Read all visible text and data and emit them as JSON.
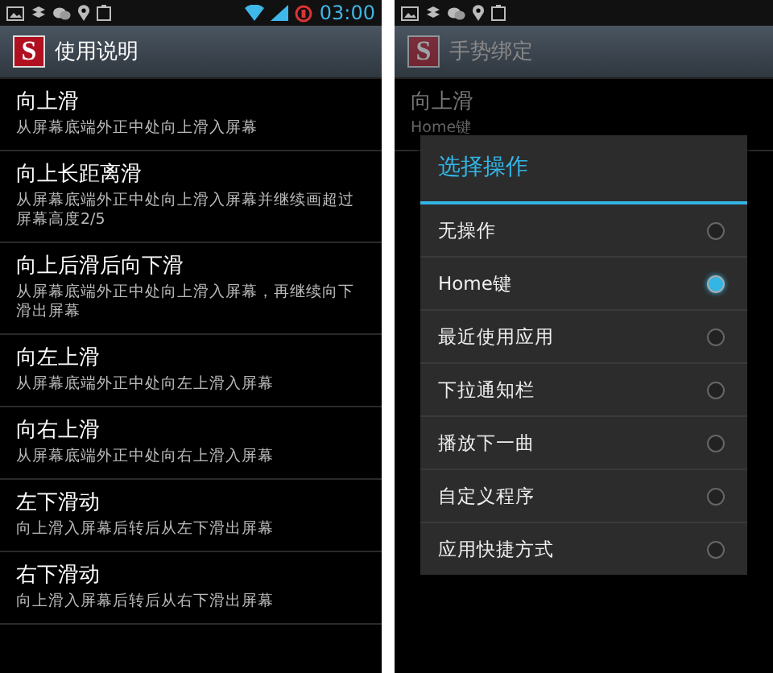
{
  "left_screen": {
    "status_bar": {
      "time": "03:00"
    },
    "app_logo": "S",
    "title": "使用说明",
    "items": [
      {
        "title": "向上滑",
        "description": "从屏幕底端外正中处向上滑入屏幕"
      },
      {
        "title": "向上长距离滑",
        "description": "从屏幕底端外正中处向上滑入屏幕并继续画超过屏幕高度2/5"
      },
      {
        "title": "向上后滑后向下滑",
        "description": "从屏幕底端外正中处向上滑入屏幕，再继续向下滑出屏幕"
      },
      {
        "title": "向左上滑",
        "description": "从屏幕底端外正中处向左上滑入屏幕"
      },
      {
        "title": "向右上滑",
        "description": "从屏幕底端外正中处向右上滑入屏幕"
      },
      {
        "title": "左下滑动",
        "description": "向上滑入屏幕后转后从左下滑出屏幕"
      },
      {
        "title": "右下滑动",
        "description": "向上滑入屏幕后转后从右下滑出屏幕"
      }
    ]
  },
  "right_screen": {
    "app_logo": "S",
    "title": "手势绑定",
    "items": [
      {
        "title": "向上滑",
        "value": "Home键"
      }
    ],
    "dialog": {
      "title": "选择操作",
      "options": [
        {
          "label": "无操作",
          "selected": false
        },
        {
          "label": "Home键",
          "selected": true
        },
        {
          "label": "最近使用应用",
          "selected": false
        },
        {
          "label": "下拉通知栏",
          "selected": false
        },
        {
          "label": "播放下一曲",
          "selected": false
        },
        {
          "label": "自定义程序",
          "selected": false
        },
        {
          "label": "应用快捷方式",
          "selected": false
        }
      ]
    }
  }
}
